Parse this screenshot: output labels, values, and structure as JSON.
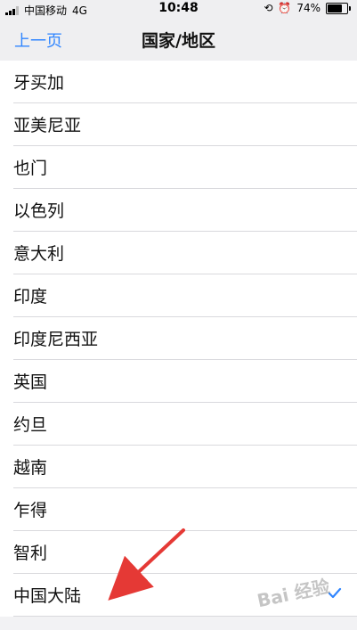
{
  "status_bar": {
    "carrier": "中国移动",
    "network": "4G",
    "time": "10:48",
    "battery": "74%",
    "battery_level": 0.74,
    "icons": [
      "signal-icon",
      "orientation-lock-icon",
      "alarm-icon",
      "battery-icon"
    ]
  },
  "nav_bar": {
    "back_label": "上一页",
    "title": "国家/地区"
  },
  "list": {
    "items": [
      {
        "label": "牙买加",
        "selected": false
      },
      {
        "label": "亚美尼亚",
        "selected": false
      },
      {
        "label": "也门",
        "selected": false
      },
      {
        "label": "以色列",
        "selected": false
      },
      {
        "label": "意大利",
        "selected": false
      },
      {
        "label": "印度",
        "selected": false
      },
      {
        "label": "印度尼西亚",
        "selected": false
      },
      {
        "label": "英国",
        "selected": false
      },
      {
        "label": "约旦",
        "selected": false
      },
      {
        "label": "越南",
        "selected": false
      },
      {
        "label": "乍得",
        "selected": false
      },
      {
        "label": "智利",
        "selected": false
      },
      {
        "label": "中国大陆",
        "selected": true
      }
    ]
  },
  "watermark": "Bai 经验",
  "colors": {
    "accent": "#2f85ff",
    "annotation_arrow": "#e53935"
  }
}
